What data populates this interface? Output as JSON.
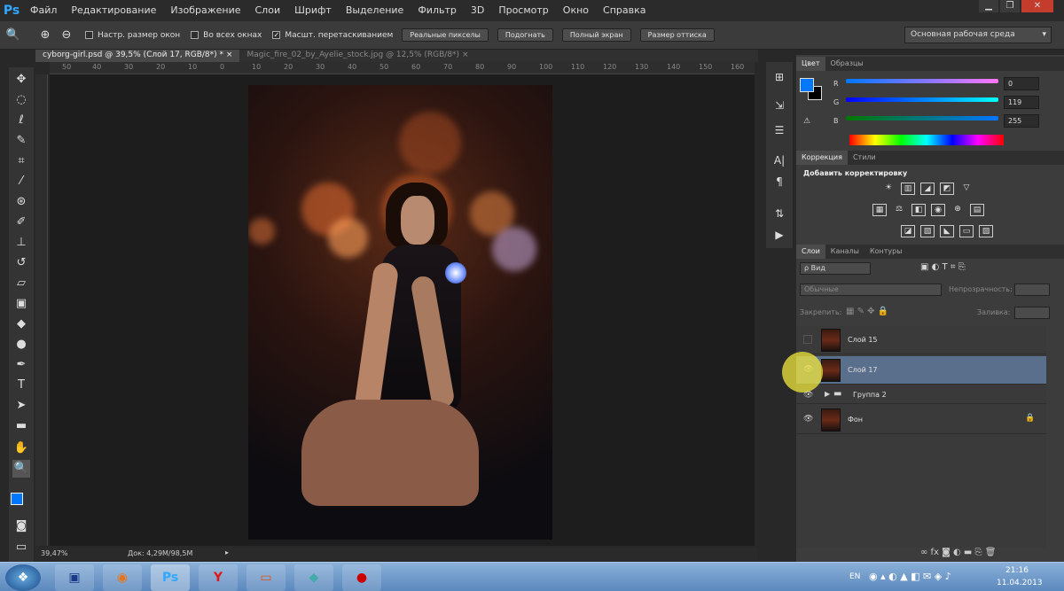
{
  "app": {
    "logo": "Ps"
  },
  "menu": [
    "Файл",
    "Редактирование",
    "Изображение",
    "Слои",
    "Шрифт",
    "Выделение",
    "Фильтр",
    "3D",
    "Просмотр",
    "Окно",
    "Справка"
  ],
  "window_controls": {
    "minimize": "▁",
    "restore": "❐",
    "close": "✕"
  },
  "options": {
    "fit_windows": "Настр. размер окон",
    "all_windows": "Во всех окнах",
    "scrubby_zoom": "Масшт. перетаскиванием",
    "actual_pixels": "Реальные пикселы",
    "fit_screen": "Подогнать",
    "fill_screen": "Полный экран",
    "print_size": "Размер оттиска",
    "workspace": "Основная рабочая среда"
  },
  "tabs": [
    {
      "label": "cyborg-girl.psd @ 39,5% (Слой 17, RGB/8*) *",
      "close": "×"
    },
    {
      "label": "Magic_fire_02_by_Ayelie_stock.jpg @ 12,5% (RGB/8*)",
      "close": "×"
    }
  ],
  "ruler": [
    "50",
    "40",
    "30",
    "20",
    "10",
    "0",
    "10",
    "20",
    "30",
    "40",
    "50",
    "60",
    "70",
    "80",
    "90",
    "100",
    "110",
    "120",
    "130",
    "140",
    "150",
    "160"
  ],
  "status": {
    "zoom": "39,47%",
    "doc": "Док: 4,29M/98,5M"
  },
  "color_panel": {
    "tabs": [
      "Цвет",
      "Образцы"
    ],
    "r_label": "R",
    "g_label": "G",
    "b_label": "B",
    "r": "0",
    "g": "119",
    "b": "255",
    "foreground": "#0077ff",
    "background": "#000000"
  },
  "adjustments_panel": {
    "tabs": [
      "Коррекция",
      "Стили"
    ],
    "title": "Добавить корректировку"
  },
  "layers_panel": {
    "tabs": [
      "Слои",
      "Каналы",
      "Контуры"
    ],
    "filter": "Вид",
    "blend_mode": "Обычные",
    "opacity_label": "Непрозрачность:",
    "lock_label": "Закрепить:",
    "fill_label": "Заливка:",
    "layers": [
      {
        "name": "Слой 15",
        "visible": false,
        "selected": false
      },
      {
        "name": "Слой 17",
        "visible": true,
        "selected": true
      },
      {
        "name": "Группа 2",
        "visible": true,
        "selected": false,
        "group": true
      },
      {
        "name": "Фон",
        "visible": true,
        "selected": false,
        "locked": true
      }
    ]
  },
  "taskbar": {
    "lang": "EN",
    "time": "21:16",
    "date": "11.04.2013"
  }
}
